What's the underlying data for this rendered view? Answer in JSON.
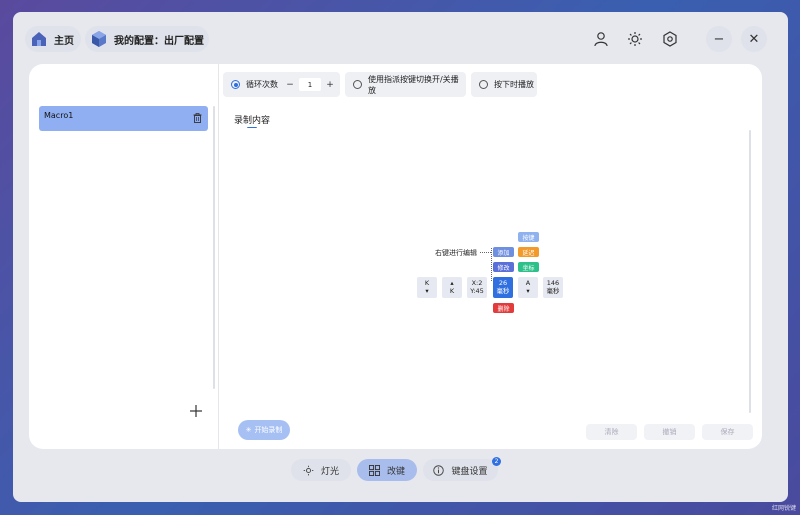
{
  "header": {
    "home_label": "主页",
    "config_label": "我的配置：出厂配置"
  },
  "sidebar": {
    "items": [
      {
        "label": "Macro1"
      }
    ]
  },
  "options": {
    "loop_label": "循环次数",
    "loop_count": "1",
    "minus": "−",
    "plus": "+",
    "toggle_label": "使用指派按键切换开/关播放",
    "hold_label": "按下时播放"
  },
  "record": {
    "title": "录制内容",
    "hint": "右键进行编辑",
    "menu": {
      "press": "按键",
      "add": "添加",
      "delay": "延迟",
      "edit": "修改",
      "move": "坐标",
      "delete": "删除"
    },
    "events": [
      {
        "line1": "K",
        "line2": "▾"
      },
      {
        "line1": "▴",
        "line2": "K"
      },
      {
        "line1": "X:2",
        "line2": "Y:45"
      },
      {
        "line1": "26",
        "line2": "毫秒"
      },
      {
        "line1": "A",
        "line2": "▾"
      },
      {
        "line1": "146",
        "line2": "毫秒"
      }
    ],
    "start_button": "开始录制",
    "clear_button": "清除",
    "undo_button": "撤销",
    "save_button": "保存"
  },
  "bottom_tabs": {
    "light": "灯光",
    "remap": "改键",
    "settings": "键盘设置",
    "settings_badge": "2"
  },
  "colors": {
    "accent": "#2f6fe0",
    "selected_item": "#90aff2",
    "tag_press": "#8fb2ee",
    "tag_add": "#6f8fe0",
    "tag_delay": "#f29a2a",
    "tag_edit": "#5a6fd8",
    "tag_move": "#2ec08a",
    "tag_delete": "#e23b3b"
  },
  "watermark": "红网锐键"
}
